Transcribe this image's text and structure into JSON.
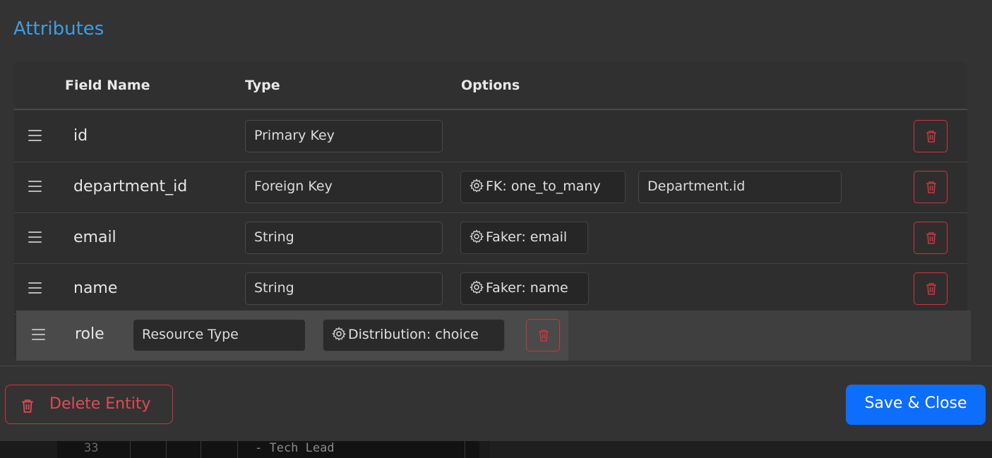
{
  "section_title": "Attributes",
  "headers": {
    "field_name": "Field Name",
    "type": "Type",
    "options": "Options"
  },
  "rows": [
    {
      "name": "id",
      "type": "Primary Key",
      "option": "",
      "ref": ""
    },
    {
      "name": "department_id",
      "type": "Foreign Key",
      "option": "FK: one_to_many",
      "ref": "Department.id"
    },
    {
      "name": "email",
      "type": "String",
      "option": "Faker: email",
      "ref": ""
    },
    {
      "name": "name",
      "type": "String",
      "option": "Faker: name",
      "ref": ""
    }
  ],
  "dragging_row": {
    "name": "role",
    "type": "Resource Type",
    "option": "Distribution: choice"
  },
  "footer": {
    "delete_label": "Delete Entity",
    "save_label": "Save & Close"
  },
  "background": {
    "line_number": "33",
    "code_line": "- Tech Lead"
  },
  "colors": {
    "accent": "#0d6efd",
    "danger": "#d0333e",
    "title": "#3d9ee0"
  }
}
